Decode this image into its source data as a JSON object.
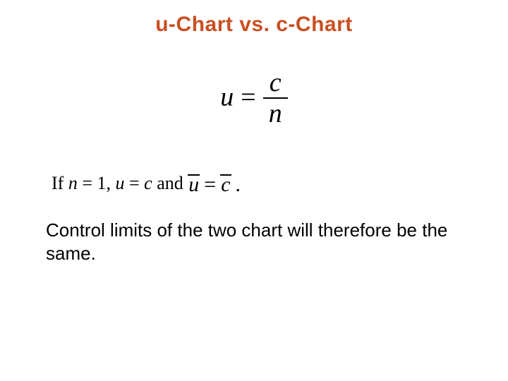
{
  "title": "u-Chart vs. c-Chart",
  "formula": {
    "lhs": "u",
    "eq": "=",
    "num": "c",
    "den": "n"
  },
  "cond": {
    "if": "If ",
    "n": "n",
    "eq1": " = 1, ",
    "u": "u",
    "eq2": " = ",
    "c": "c",
    "and": " and ",
    "ubar": "u",
    "eqsym": "=",
    "cbar": "c",
    "period": "."
  },
  "conclusion": "Control limits of the two chart will therefore be the same."
}
